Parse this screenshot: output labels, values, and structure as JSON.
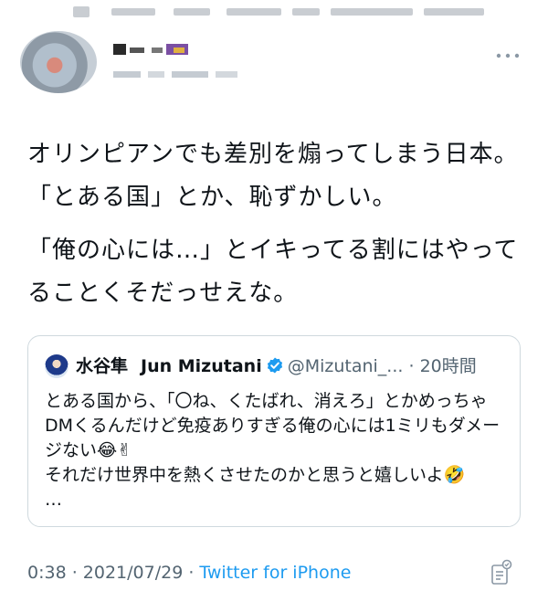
{
  "tweet": {
    "lines": [
      "オリンピアンでも差別を煽ってしまう日本。「とある国」とか、恥ずかしい。",
      "「俺の心には…」とイキってる割にはやってることくそだっせえな。"
    ]
  },
  "quote": {
    "name_ja": "水谷隼",
    "name_en": "Jun Mizutani",
    "handle": "@Mizutani_...",
    "time": "· 20時間",
    "body": [
      "とある国から、「〇ね、くたばれ、消えろ」とかめっちゃDMくるんだけど免疫ありすぎる俺の心には1ミリもダメージない😂✌",
      "それだけ世界中を熱くさせたのかと思うと嬉しいよ🤣",
      "…"
    ]
  },
  "footer": {
    "time": "0:38 · 2021/07/29 · ",
    "source": "Twitter for iPhone"
  },
  "icons": {
    "more": "more-icon",
    "verified": "verified-icon",
    "analytics": "analytics-icon"
  },
  "colors": {
    "link": "#1d9bf0",
    "muted": "#536471",
    "verified": "#1d9bf0",
    "border": "#cfd9de"
  }
}
